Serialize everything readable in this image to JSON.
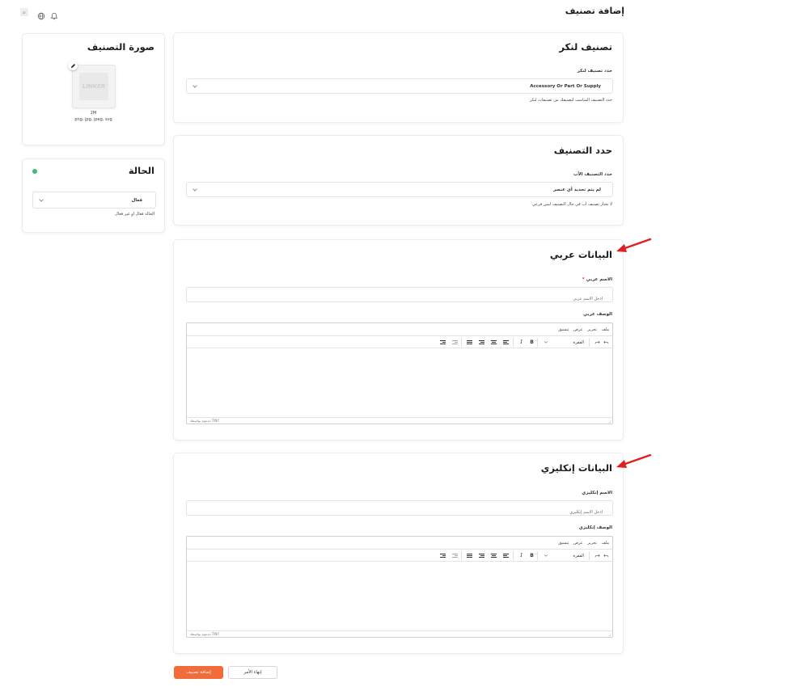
{
  "header": {
    "page_title": "إضافة تصنيف",
    "badge": "ar"
  },
  "image_card": {
    "title": "صورة التصنيف",
    "logo_text": "LINKER",
    "size": "2M",
    "formats": "png, jpg, jpeg, svg"
  },
  "status_card": {
    "title": "الحالة",
    "status_color": "#3fbf6d",
    "select_value": "فعال",
    "hint": "الحالة فعال او غير فعال"
  },
  "linker_card": {
    "title": "تصنيف لنكر",
    "label": "حدد تصنيف لنكر",
    "select_value": "Accessory Or Part Or Supply",
    "hint": "حدد التصنيف المناسب لتصنيفك من تصنيفات لنكر"
  },
  "category_card": {
    "title": "حدد التصنيف",
    "label": "حدد التصنيف الأب",
    "select_value": "لم يتم تحديد أي عنصر",
    "hint": "لا تختار تصنيف أب في حال التصنيف ليس فرعي"
  },
  "arabic_card": {
    "title": "البيانات عربي",
    "name_label": "الاسم عربي",
    "required_mark": "*",
    "name_placeholder": "ادخل الاسم عربي",
    "desc_label": "الوصف عربي"
  },
  "english_card": {
    "title": "البيانات إنكليزي",
    "name_label": "الاسم إنكليزي",
    "name_placeholder": "ادخل الاسم إنكليزي",
    "desc_label": "الوصف إنكليزي"
  },
  "editor": {
    "menu": [
      "ملف",
      "تحرير",
      "عرض",
      "تنسيق"
    ],
    "block_format": "الفقرة",
    "bold": "B",
    "italic": "I",
    "status": "مدعوم بواسطة TINY"
  },
  "footer": {
    "submit_label": "إضافة تصنيف",
    "cancel_label": "إنهاء الأمر"
  },
  "colors": {
    "accent": "#f26b3a",
    "annotation_arrow": "#e02020"
  }
}
